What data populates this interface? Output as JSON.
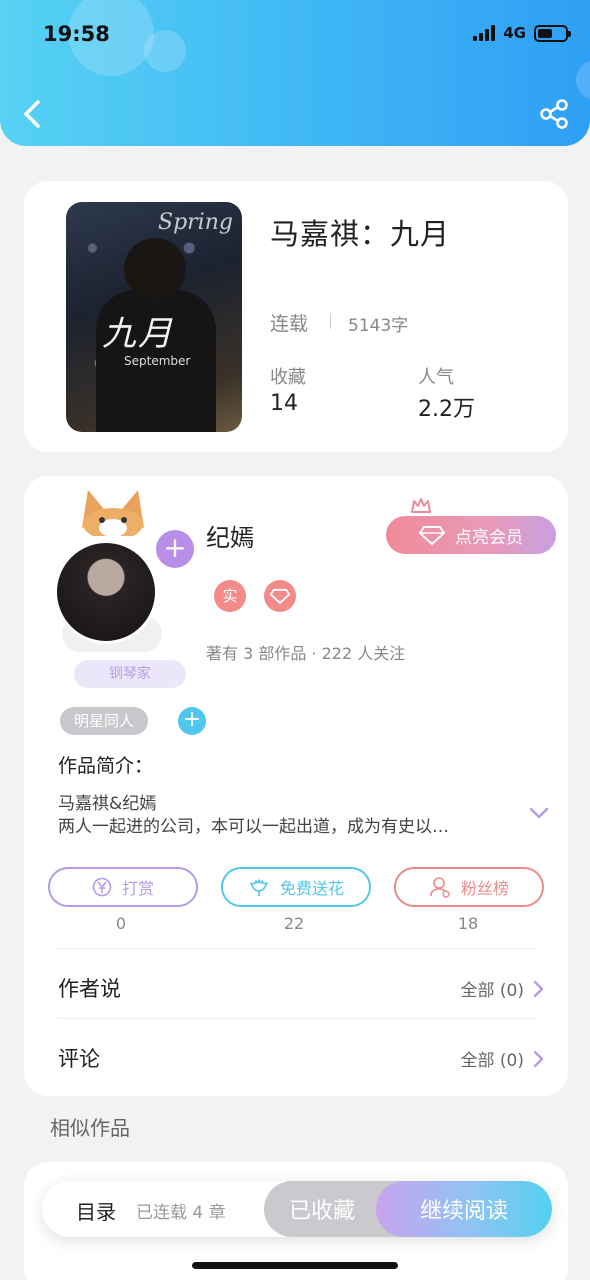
{
  "status_bar": {
    "time": "19:58",
    "network": "4G"
  },
  "book": {
    "cover_title": "九月",
    "cover_subtitle": "September",
    "cover_spring": "Spring",
    "title": "马嘉祺：九月",
    "status": "连载",
    "word_count": "5143字",
    "favorites_label": "收藏",
    "favorites_value": "14",
    "popularity_label": "人气",
    "popularity_value": "2.2万"
  },
  "author": {
    "name": "纪嫣",
    "vip_label": "点亮会员",
    "badge": "钢琴家",
    "tag_real": "实",
    "meta": "著有 3 部作品 · 222 人关注"
  },
  "work": {
    "genre_tag": "明星同人",
    "intro_label": "作品简介：",
    "intro_line1": "马嘉祺&纪嫣",
    "intro_line2": "两人一起进的公司，本可以一起出道，成为有史以…"
  },
  "actions": [
    {
      "label": "打赏",
      "count": "0",
      "color": "#b69be6"
    },
    {
      "label": "免费送花",
      "count": "22",
      "color": "#52c7e8"
    },
    {
      "label": "粉丝榜",
      "count": "18",
      "color": "#ee8a8a"
    }
  ],
  "rows": {
    "author_says_label": "作者说",
    "author_says_all": "全部 (0)",
    "comments_label": "评论",
    "comments_all": "全部 (0)"
  },
  "similar_title": "相似作品",
  "bottom_bar": {
    "toc_label": "目录",
    "toc_count": "已连载 4 章",
    "favorited_label": "已收藏",
    "continue_label": "继续阅读"
  },
  "icons": [
    "back-icon",
    "share-icon",
    "diamond-icon",
    "crown-icon",
    "yen-icon",
    "flower-icon",
    "user-icon",
    "chevron-right-icon",
    "chevron-down-icon",
    "plus-icon"
  ]
}
